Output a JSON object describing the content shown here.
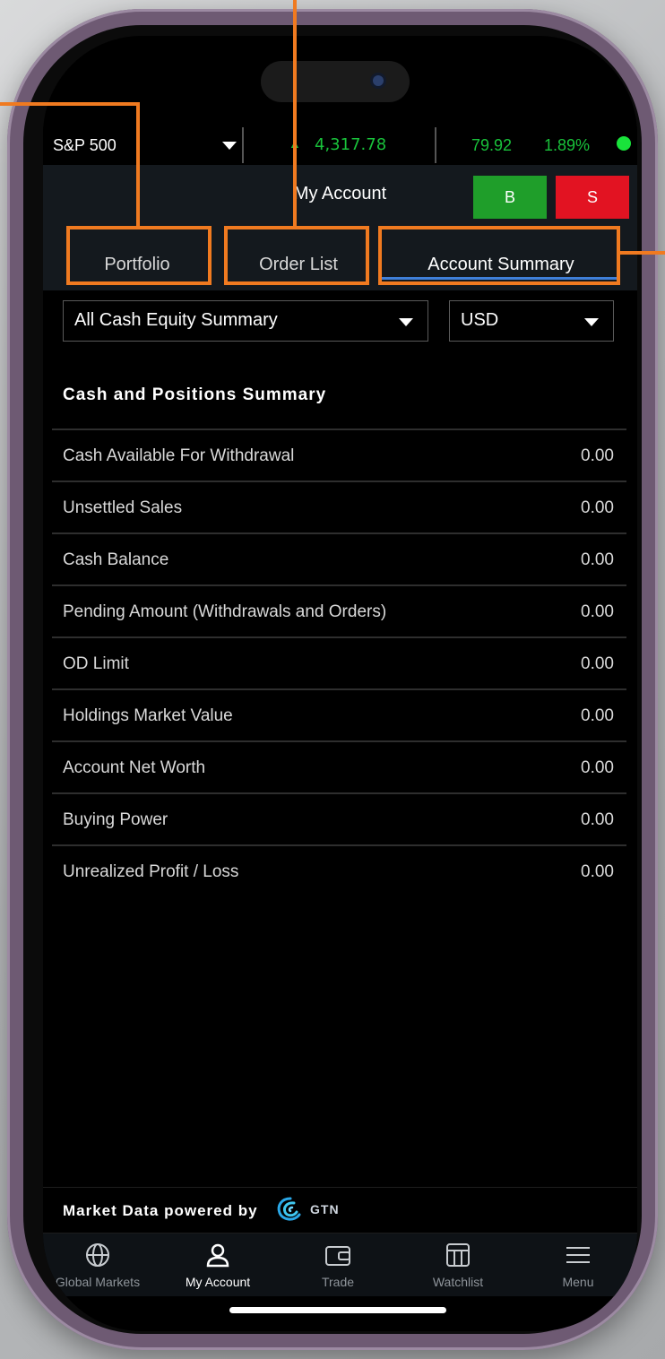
{
  "ticker": {
    "symbol": "S&P 500",
    "price": "4,317.78",
    "change": "79.92",
    "change_pct": "1.89%",
    "status_color": "#19e33b"
  },
  "header": {
    "title": "My Account",
    "buy_label": "B",
    "sell_label": "S"
  },
  "tabs": [
    {
      "label": "Portfolio"
    },
    {
      "label": "Order List"
    },
    {
      "label": "Account Summary",
      "active": true
    }
  ],
  "filters": {
    "summary_type": "All Cash Equity Summary",
    "currency": "USD"
  },
  "section": {
    "title": "Cash and Positions Summary"
  },
  "rows": [
    {
      "label": "Cash Available For Withdrawal",
      "value": "0.00"
    },
    {
      "label": "Unsettled Sales",
      "value": "0.00"
    },
    {
      "label": "Cash Balance",
      "value": "0.00"
    },
    {
      "label": "Pending Amount (Withdrawals and Orders)",
      "value": "0.00"
    },
    {
      "label": "OD Limit",
      "value": "0.00"
    },
    {
      "label": "Holdings Market Value",
      "value": "0.00"
    },
    {
      "label": "Account Net Worth",
      "value": "0.00"
    },
    {
      "label": "Buying Power",
      "value": "0.00"
    },
    {
      "label": "Unrealized Profit / Loss",
      "value": "0.00"
    }
  ],
  "footer": {
    "powered_text": "Market Data powered by",
    "brand": "GTN"
  },
  "nav": [
    {
      "label": "Global Markets",
      "icon": "globe-icon"
    },
    {
      "label": "My Account",
      "icon": "user-icon",
      "active": true
    },
    {
      "label": "Trade",
      "icon": "wallet-icon"
    },
    {
      "label": "Watchlist",
      "icon": "watchlist-icon"
    },
    {
      "label": "Menu",
      "icon": "menu-icon"
    }
  ],
  "colors": {
    "accent_green": "#19c23b",
    "buy": "#1f9e2a",
    "sell": "#e21322",
    "tab_active_underline": "#3f7fd8",
    "annotation_outline": "#f07a20"
  }
}
